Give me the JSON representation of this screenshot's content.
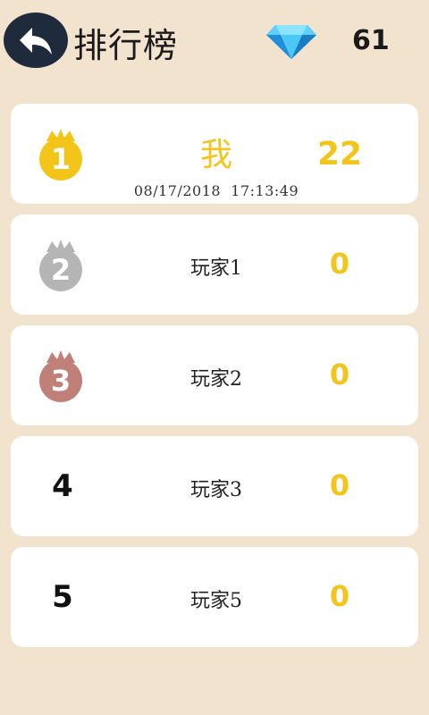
{
  "header": {
    "title": "排行榜",
    "back_icon": "back-arrow-icon",
    "gem_icon": "diamond-icon",
    "gem_count": "61"
  },
  "colors": {
    "background": "#f2e3cf",
    "score": "#f3c51b",
    "gold": "#f3c51b",
    "silver": "#b5b5b5",
    "bronze": "#c08078"
  },
  "leaderboard": [
    {
      "rank": "1",
      "badge": "gold-crown-medal-icon",
      "name": "我",
      "score": "22",
      "timestamp": "08/17/2018  17:13:49"
    },
    {
      "rank": "2",
      "badge": "silver-crown-medal-icon",
      "name": "玩家1",
      "score": "0"
    },
    {
      "rank": "3",
      "badge": "bronze-crown-medal-icon",
      "name": "玩家2",
      "score": "0"
    },
    {
      "rank": "4",
      "name": "玩家3",
      "score": "0"
    },
    {
      "rank": "5",
      "name": "玩家5",
      "score": "0"
    }
  ]
}
